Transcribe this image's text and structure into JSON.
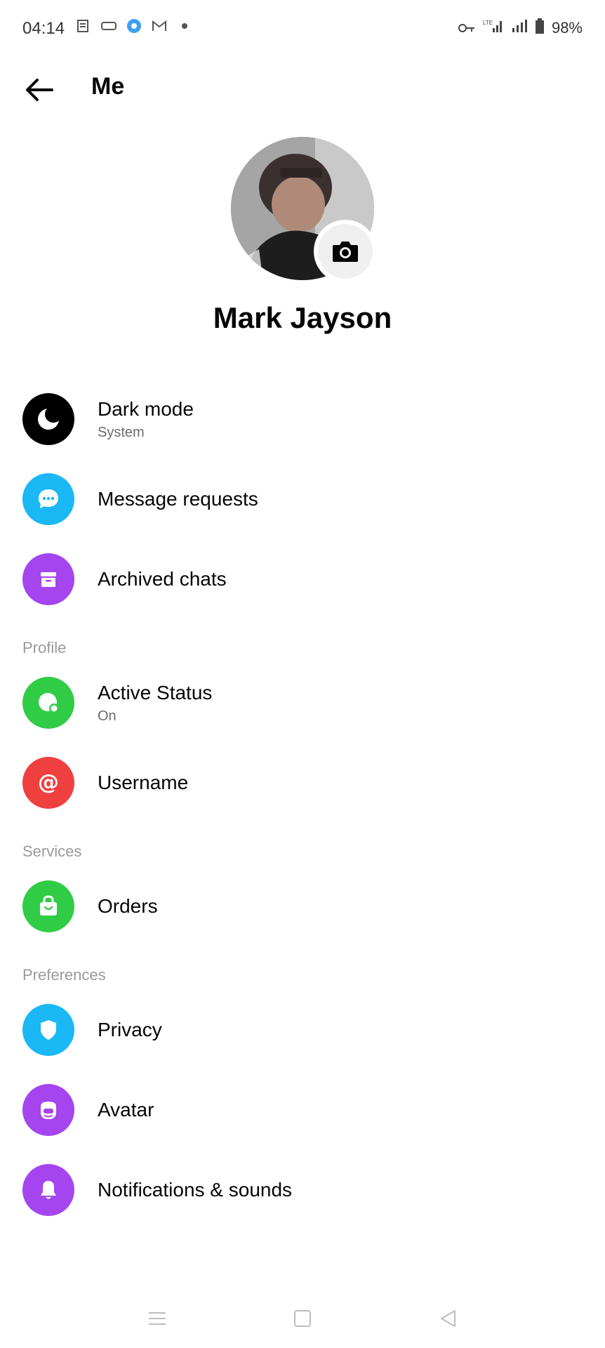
{
  "status_bar": {
    "time": "04:14",
    "battery": "98%",
    "left_icons": [
      "news-icon",
      "vr-icon",
      "app-icon",
      "gmail-icon",
      "dot-icon"
    ],
    "right_icons": [
      "vpn-key-icon",
      "lte-signal-icon",
      "signal-icon",
      "battery-icon"
    ]
  },
  "header": {
    "title": "Me"
  },
  "profile": {
    "name": "Mark Jayson"
  },
  "settings": {
    "dark_mode": {
      "label": "Dark mode",
      "sub": "System",
      "color": "#000000",
      "icon": "moon-icon"
    },
    "message_requests": {
      "label": "Message requests",
      "color": "#1ab8f5",
      "icon": "chat-bubble-icon"
    },
    "archived_chats": {
      "label": "Archived chats",
      "color": "#a445f0",
      "icon": "archive-box-icon"
    },
    "profile_header": "Profile",
    "active_status": {
      "label": "Active Status",
      "sub": "On",
      "color": "#31cc46",
      "icon": "active-status-icon"
    },
    "username": {
      "label": "Username",
      "color": "#f03f3f",
      "icon": "at-sign-icon"
    },
    "services_header": "Services",
    "orders": {
      "label": "Orders",
      "color": "#31cc46",
      "icon": "shopping-bag-icon"
    },
    "preferences_header": "Preferences",
    "privacy": {
      "label": "Privacy",
      "color": "#1ab8f5",
      "icon": "shield-icon"
    },
    "avatar": {
      "label": "Avatar",
      "color": "#a445f0",
      "icon": "avatar-face-icon"
    },
    "notifications": {
      "label": "Notifications & sounds",
      "color": "#a445f0",
      "icon": "bell-icon"
    }
  },
  "nav": {
    "icons": [
      "menu-icon",
      "home-square-icon",
      "back-triangle-icon"
    ]
  }
}
